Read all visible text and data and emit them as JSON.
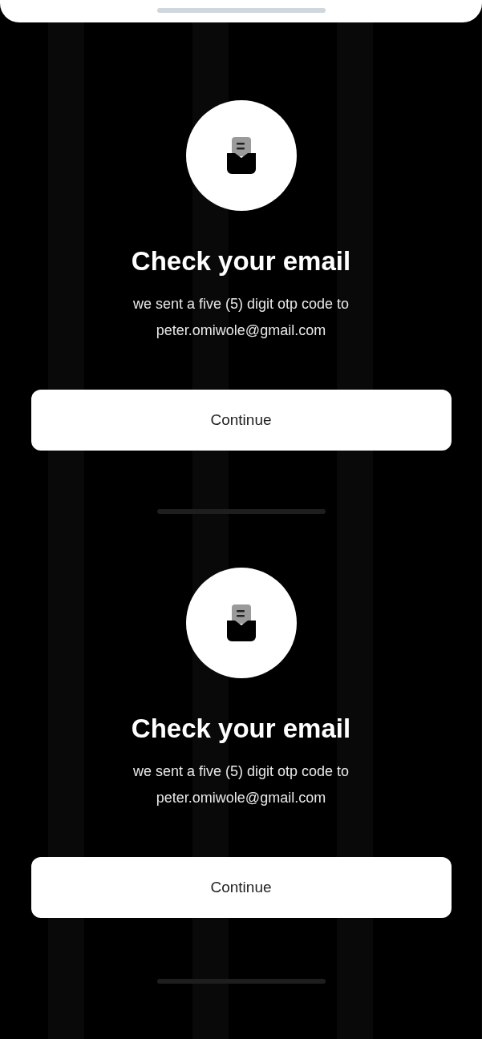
{
  "screens": [
    {
      "title": "Check your email",
      "message": "we sent a five (5) digit otp code to",
      "email": "peter.omiwole@gmail.com",
      "button": "Continue"
    },
    {
      "title": "Check your email",
      "message": "we sent a five (5) digit otp code to",
      "email": "peter.omiwole@gmail.com",
      "button": "Continue"
    }
  ]
}
